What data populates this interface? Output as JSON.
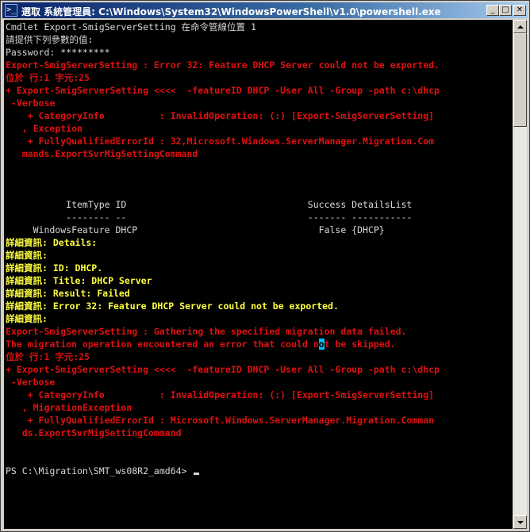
{
  "window": {
    "title": "選取 系統管理員: C:\\Windows\\System32\\WindowsPowerShell\\v1.0\\powershell.exe",
    "icon": "powershell-icon",
    "buttons": {
      "minimize": "_",
      "maximize": "□",
      "close": "✕"
    }
  },
  "colors": {
    "background": "#000000",
    "text": "#d8d8d8",
    "error": "#e01010",
    "verbose": "#ffff40",
    "titlebar": "#0a246a"
  },
  "console": {
    "lines": [
      {
        "text": "Cmdlet Export-SmigServerSetting 在命令管線位置 1",
        "style": "w"
      },
      {
        "text": "請提供下列參數的值:",
        "style": "w"
      },
      {
        "text": "Password: *********",
        "style": "w"
      },
      {
        "text": "Export-SmigServerSetting : Error 32: Feature DHCP Server could not be exported.",
        "style": "r"
      },
      {
        "text": "位於 行:1 字元:25",
        "style": "r"
      },
      {
        "text": "+ Export-SmigServerSetting <<<<  -featureID DHCP -User All -Group -path c:\\dhcp",
        "style": "r"
      },
      {
        "text": " -Verbose",
        "style": "r"
      },
      {
        "text": "    + CategoryInfo          : InvalidOperation: (:) [Export-SmigServerSetting]",
        "style": "r"
      },
      {
        "text": "   , Exception",
        "style": "r"
      },
      {
        "text": "    + FullyQualifiedErrorId : 32,Microsoft.Windows.ServerManager.Migration.Com",
        "style": "r"
      },
      {
        "text": "   mands.ExportSvrMigSettingCommand",
        "style": "r"
      },
      {
        "text": "",
        "style": "w"
      },
      {
        "text": "",
        "style": "w"
      },
      {
        "text": "",
        "style": "w"
      },
      {
        "text": "           ItemType ID                                 Success DetailsList",
        "style": "w"
      },
      {
        "text": "           -------- --                                 ------- -----------",
        "style": "w"
      },
      {
        "text": "     WindowsFeature DHCP                                 False {DHCP}",
        "style": "w"
      },
      {
        "text": "詳細資訊: Details:",
        "style": "y"
      },
      {
        "text": "詳細資訊:",
        "style": "y"
      },
      {
        "text": "詳細資訊: ID: DHCP.",
        "style": "y"
      },
      {
        "text": "詳細資訊: Title: DHCP Server",
        "style": "y"
      },
      {
        "text": "詳細資訊: Result: Failed",
        "style": "y"
      },
      {
        "text": "詳細資訊: Error 32: Feature DHCP Server could not be exported.",
        "style": "y"
      },
      {
        "text": "詳細資訊:",
        "style": "y"
      },
      {
        "text": "Export-SmigServerSetting : Gathering the specified migration data failed.",
        "style": "r"
      },
      {
        "text": "The migration operation encountered an error that could not be skipped.",
        "style": "r",
        "highlight_char": 57
      },
      {
        "text": "位於 行:1 字元:25",
        "style": "r"
      },
      {
        "text": "+ Export-SmigServerSetting <<<<  -featureID DHCP -User All -Group -path c:\\dhcp",
        "style": "r"
      },
      {
        "text": " -Verbose",
        "style": "r"
      },
      {
        "text": "    + CategoryInfo          : InvalidOperation: (:) [Export-SmigServerSetting]",
        "style": "r"
      },
      {
        "text": "   , MigrationException",
        "style": "r"
      },
      {
        "text": "    + FullyQualifiedErrorId : Microsoft.Windows.ServerManager.Migration.Comman",
        "style": "r"
      },
      {
        "text": "   ds.ExportSvrMigSettingCommand",
        "style": "r"
      },
      {
        "text": "",
        "style": "w"
      },
      {
        "text": "",
        "style": "w"
      },
      {
        "text": "PS C:\\Migration\\SMT_ws08R2_amd64> ",
        "style": "w",
        "prompt": true
      }
    ]
  }
}
